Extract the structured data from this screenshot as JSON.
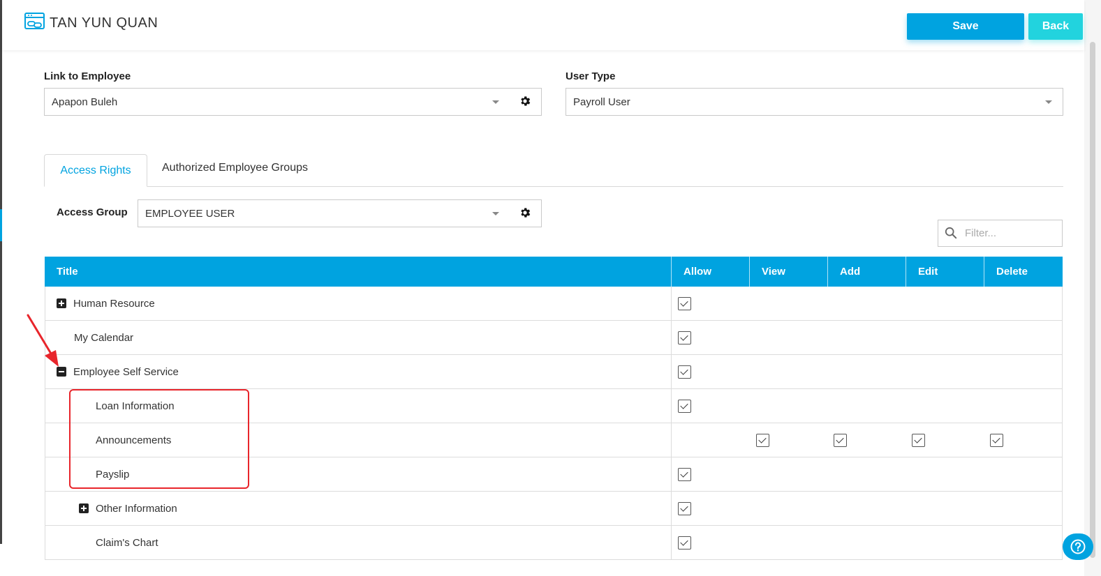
{
  "header": {
    "title": "TAN YUN QUAN",
    "save_label": "Save",
    "back_label": "Back",
    "icon": "user-link-icon"
  },
  "form": {
    "link_to_employee": {
      "label": "Link to Employee",
      "value": "Apapon Buleh"
    },
    "user_type": {
      "label": "User Type",
      "value": "Payroll User"
    }
  },
  "tabs": [
    {
      "label": "Access Rights",
      "active": true
    },
    {
      "label": "Authorized Employee Groups",
      "active": false
    }
  ],
  "access_group": {
    "label": "Access Group",
    "value": "EMPLOYEE USER"
  },
  "filter": {
    "placeholder": "Filter..."
  },
  "grid": {
    "columns": [
      "Title",
      "Allow",
      "View",
      "Add",
      "Edit",
      "Delete"
    ],
    "rows": [
      {
        "title": "Human Resource",
        "level": 0,
        "expander": "plus",
        "allow": true,
        "view": false,
        "add": false,
        "edit": false,
        "delete": false
      },
      {
        "title": "My Calendar",
        "level": 0,
        "expander": "none",
        "allow": true,
        "view": false,
        "add": false,
        "edit": false,
        "delete": false
      },
      {
        "title": "Employee Self Service",
        "level": 0,
        "expander": "minus",
        "allow": true,
        "view": false,
        "add": false,
        "edit": false,
        "delete": false
      },
      {
        "title": "Loan Information",
        "level": 1,
        "expander": "none",
        "allow": true,
        "view": false,
        "add": false,
        "edit": false,
        "delete": false
      },
      {
        "title": "Announcements",
        "level": 1,
        "expander": "none",
        "allow": false,
        "view": true,
        "add": true,
        "edit": true,
        "delete": true
      },
      {
        "title": "Payslip",
        "level": 1,
        "expander": "none",
        "allow": true,
        "view": false,
        "add": false,
        "edit": false,
        "delete": false
      },
      {
        "title": "Other Information",
        "level": 1,
        "expander": "plus",
        "allow": true,
        "view": false,
        "add": false,
        "edit": false,
        "delete": false
      },
      {
        "title": "Claim's Chart",
        "level": 1,
        "expander": "none",
        "allow": true,
        "view": false,
        "add": false,
        "edit": false,
        "delete": false
      }
    ]
  },
  "colors": {
    "primary": "#00a3e0",
    "back_button": "#22d3de",
    "annotation": "#e8252b"
  }
}
